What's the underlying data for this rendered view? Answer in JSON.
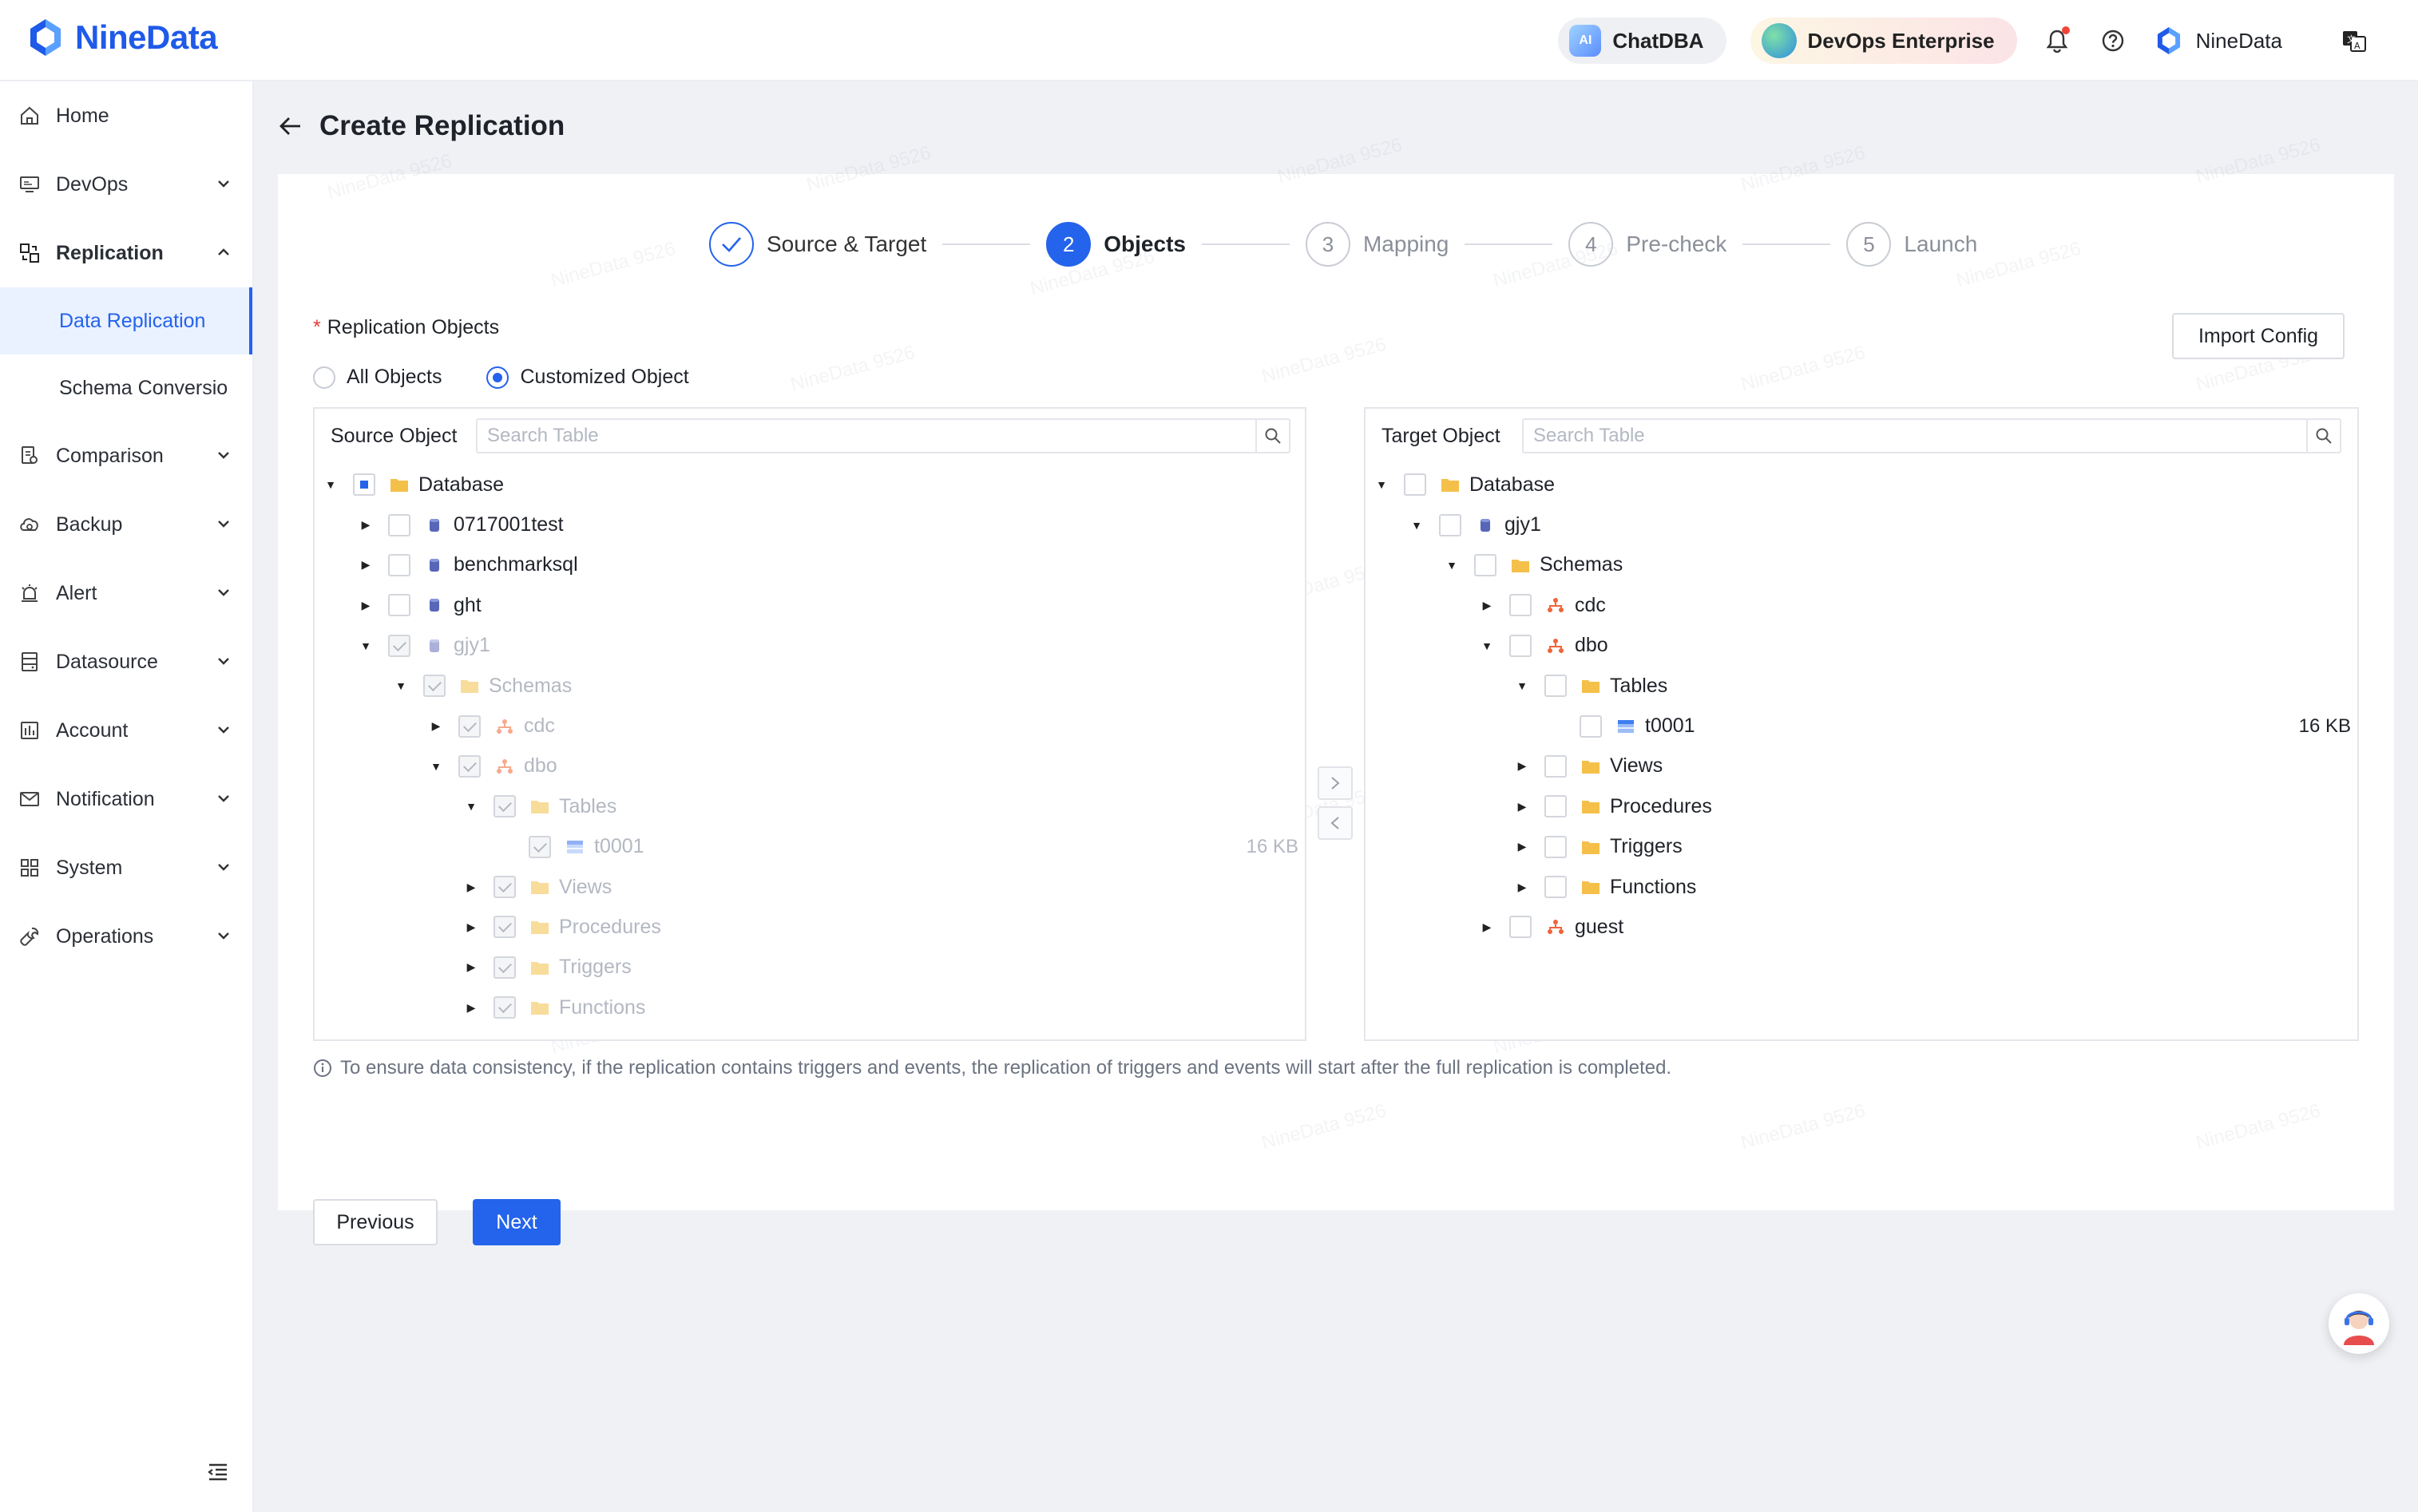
{
  "app": {
    "logo_text": "NineData"
  },
  "topbar": {
    "chatdba": "ChatDBA",
    "ai_badge": "AI",
    "devops": "DevOps Enterprise",
    "user": "NineData"
  },
  "sidebar": {
    "items": [
      {
        "label": "Home"
      },
      {
        "label": "DevOps"
      },
      {
        "label": "Replication"
      },
      {
        "label": "Comparison"
      },
      {
        "label": "Backup"
      },
      {
        "label": "Alert"
      },
      {
        "label": "Datasource"
      },
      {
        "label": "Account"
      },
      {
        "label": "Notification"
      },
      {
        "label": "System"
      },
      {
        "label": "Operations"
      }
    ],
    "subitems": [
      {
        "label": "Data Replication"
      },
      {
        "label": "Schema Conversio"
      }
    ]
  },
  "page": {
    "title": "Create Replication"
  },
  "steps": [
    {
      "num": "1",
      "label": "Source & Target"
    },
    {
      "num": "2",
      "label": "Objects"
    },
    {
      "num": "3",
      "label": "Mapping"
    },
    {
      "num": "4",
      "label": "Pre-check"
    },
    {
      "num": "5",
      "label": "Launch"
    }
  ],
  "form": {
    "objects_label": "Replication Objects",
    "import_config": "Import Config",
    "radio_all": "All Objects",
    "radio_custom": "Customized Object",
    "selected_radio": "Customized Object"
  },
  "source": {
    "title": "Source Object",
    "search_placeholder": "Search Table",
    "rows": [
      {
        "label": "Database"
      },
      {
        "label": "0717001test"
      },
      {
        "label": "benchmarksql"
      },
      {
        "label": "ght"
      },
      {
        "label": "gjy1"
      },
      {
        "label": "Schemas"
      },
      {
        "label": "cdc"
      },
      {
        "label": "dbo"
      },
      {
        "label": "Tables"
      },
      {
        "label": "t0001",
        "size": "16 KB"
      },
      {
        "label": "Views"
      },
      {
        "label": "Procedures"
      },
      {
        "label": "Triggers"
      },
      {
        "label": "Functions"
      }
    ]
  },
  "target": {
    "title": "Target Object",
    "search_placeholder": "Search Table",
    "rows": [
      {
        "label": "Database"
      },
      {
        "label": "gjy1"
      },
      {
        "label": "Schemas"
      },
      {
        "label": "cdc"
      },
      {
        "label": "dbo"
      },
      {
        "label": "Tables"
      },
      {
        "label": "t0001",
        "size": "16 KB"
      },
      {
        "label": "Views"
      },
      {
        "label": "Procedures"
      },
      {
        "label": "Triggers"
      },
      {
        "label": "Functions"
      },
      {
        "label": "guest"
      }
    ]
  },
  "notice": "To ensure data consistency, if the replication contains triggers and events, the replication of triggers and events will start after the full replication is completed.",
  "buttons": {
    "previous": "Previous",
    "next": "Next"
  },
  "watermark": "NineData 9526",
  "colors": {
    "primary": "#2463eb",
    "schema_icon": "#f0643a",
    "folder_icon": "#f5c04a"
  }
}
